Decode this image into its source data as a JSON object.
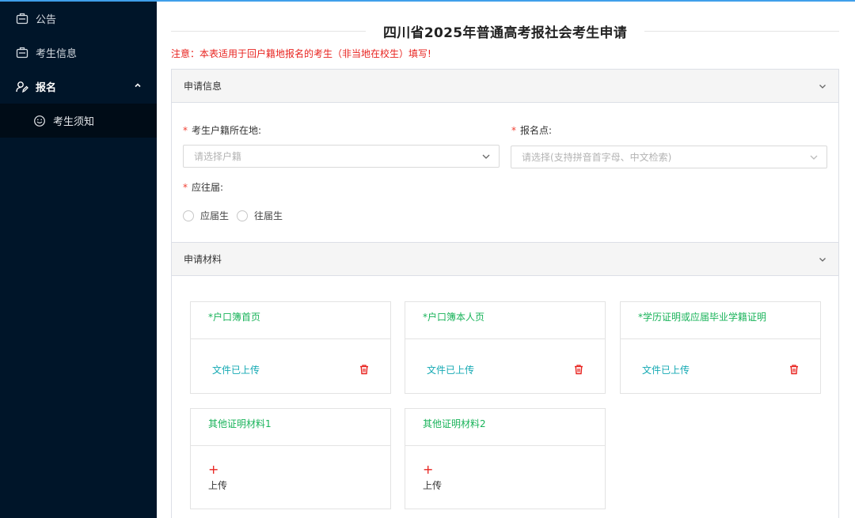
{
  "sidebar": {
    "items": [
      {
        "label": "公告",
        "icon": "briefcase-icon"
      },
      {
        "label": "考生信息",
        "icon": "briefcase-icon"
      },
      {
        "label": "报名",
        "icon": "user-edit-icon",
        "expanded": true
      }
    ],
    "sub_items": [
      {
        "label": "考生须知",
        "icon": "smile-icon"
      }
    ]
  },
  "page": {
    "title": "四川省2025年普通高考报社会考生申请",
    "notice": "注意：本表适用于回户籍地报名的考生（非当地在校生）填写!"
  },
  "section_info": {
    "title": "申请信息",
    "hukou": {
      "label": "考生户籍所在地:",
      "placeholder": "请选择户籍"
    },
    "site": {
      "label": "报名点:",
      "placeholder": "请选择(支持拼音首字母、中文检索)"
    },
    "grad": {
      "label": "应往届:",
      "options": [
        "应届生",
        "往届生"
      ]
    }
  },
  "section_materials": {
    "title": "申请材料",
    "cards": [
      {
        "title": "*户口簿首页",
        "status": "文件已上传"
      },
      {
        "title": "*户口簿本人页",
        "status": "文件已上传"
      },
      {
        "title": "*学历证明或应届毕业学籍证明",
        "status": "文件已上传"
      },
      {
        "title": "其他证明材料1",
        "upload_label": "上传"
      },
      {
        "title": "其他证明材料2",
        "upload_label": "上传"
      }
    ]
  },
  "colors": {
    "sidebar_bg": "#001529",
    "accent_blue": "#3f9fea",
    "notice_red": "#e8231f",
    "card_title_green": "#19b35a",
    "uploaded_teal": "#14a9b3"
  }
}
